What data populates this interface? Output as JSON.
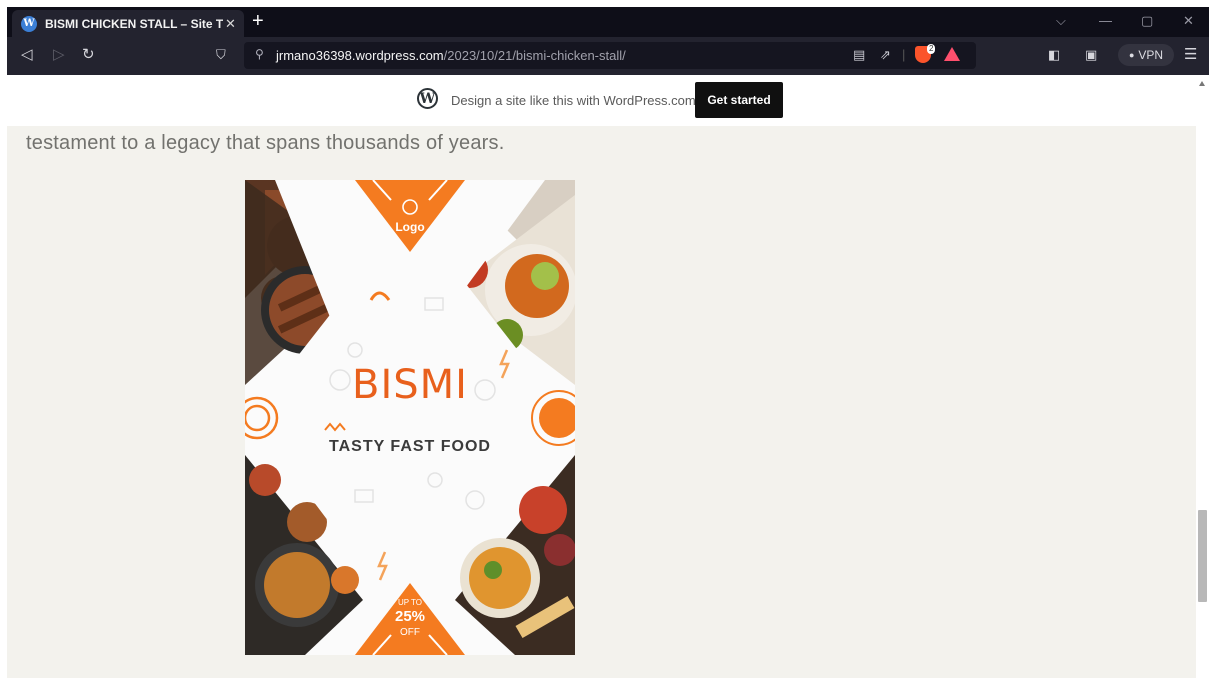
{
  "browser": {
    "tab": {
      "title": "BISMI CHICKEN STALL – Site Title",
      "close_icon": "close-icon"
    },
    "new_tab_icon": "plus-icon",
    "window_controls": [
      "chevron-down-icon",
      "minimize-icon",
      "restore-icon",
      "close-icon"
    ],
    "nav": {
      "back_icon": "back-icon",
      "forward_icon": "forward-icon",
      "reload_icon": "reload-icon",
      "bookmark_icon": "bookmark-icon"
    },
    "address_bar": {
      "host": "jrmano36398.wordpress.com",
      "path": "/2023/10/21/bismi-chicken-stall/"
    },
    "brave_shields_count": "2",
    "vpn_label": "VPN"
  },
  "wp_banner": {
    "text": "Design a site like this with WordPress.com",
    "cta": "Get started"
  },
  "article": {
    "paragraph_tail": "testament to a legacy that spans thousands of years."
  },
  "poster": {
    "logo": "Logo",
    "brand": "BISMI",
    "tagline": "TASTY FAST FOOD",
    "promo_upto": "UP TO",
    "promo_pct": "25%",
    "promo_off": "OFF"
  },
  "colors": {
    "accent_orange": "#f47b20",
    "brand_orange": "#e8601c",
    "page_bg": "#f3f2ed"
  }
}
